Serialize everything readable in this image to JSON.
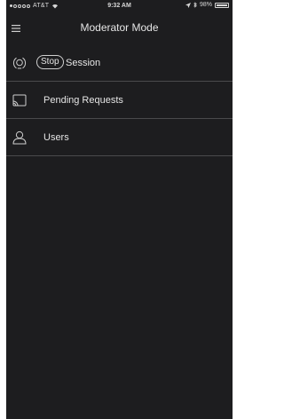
{
  "status_bar": {
    "carrier": "AT&T",
    "time": "9:32 AM",
    "battery": "98%",
    "battery_level": 0.98
  },
  "nav": {
    "title": "Moderator Mode",
    "menu_icon": "hamburger-menu-icon"
  },
  "menu": {
    "session": {
      "icon": "broadcast-icon",
      "stop_label": "Stop",
      "label": "Session"
    },
    "pending": {
      "icon": "cast-icon",
      "label": "Pending Requests"
    },
    "users": {
      "icon": "user-icon",
      "label": "Users"
    }
  },
  "colors": {
    "background": "#1d1d1f",
    "divider": "#4a4a4c",
    "text": "#e6e6e6"
  }
}
